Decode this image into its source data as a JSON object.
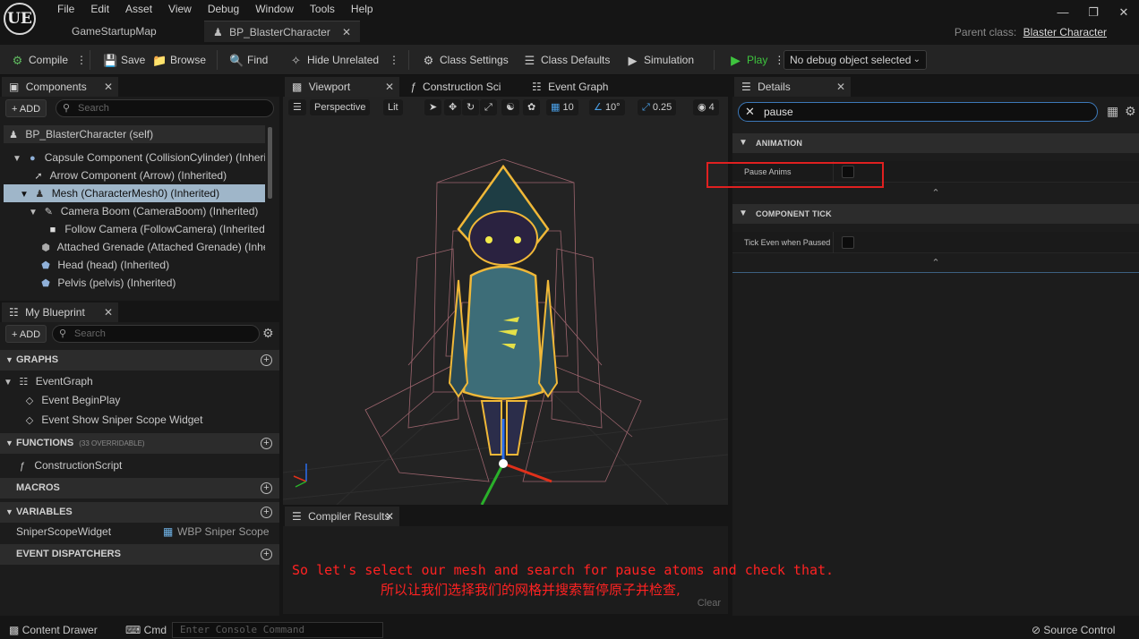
{
  "app": {
    "logo": "UE"
  },
  "menu": [
    "File",
    "Edit",
    "Asset",
    "View",
    "Debug",
    "Window",
    "Tools",
    "Help"
  ],
  "window_controls": {
    "minimize": "—",
    "maximize": "❐",
    "close": "✕"
  },
  "doc_tabs": [
    {
      "label": "GameStartupMap"
    },
    {
      "label": "BP_BlasterCharacter",
      "close": "✕"
    }
  ],
  "parent_class": {
    "label": "Parent class:",
    "value": "Blaster Character"
  },
  "toolbar": {
    "compile": "Compile",
    "save": "Save",
    "browse": "Browse",
    "find": "Find",
    "hide_unrelated": "Hide Unrelated",
    "class_settings": "Class Settings",
    "class_defaults": "Class Defaults",
    "simulation": "Simulation",
    "play": "Play",
    "debug_select": "No debug object selected",
    "accent_play": "#3ec43e"
  },
  "components": {
    "tab": "Components",
    "add": "ADD",
    "search_placeholder": "Search",
    "items": [
      {
        "label": "BP_BlasterCharacter (self)"
      },
      {
        "label": "Capsule Component (CollisionCylinder) (Inherite"
      },
      {
        "label": "Arrow Component (Arrow) (Inherited)"
      },
      {
        "label": "Mesh (CharacterMesh0) (Inherited)"
      },
      {
        "label": "Camera Boom (CameraBoom) (Inherited)"
      },
      {
        "label": "Follow Camera (FollowCamera) (Inherited)"
      },
      {
        "label": "Attached Grenade (Attached Grenade) (Inheri"
      },
      {
        "label": "Head (head) (Inherited)"
      },
      {
        "label": "Pelvis (pelvis) (Inherited)"
      }
    ],
    "selected_color": "#9fb6c9"
  },
  "my_blueprint": {
    "tab": "My Blueprint",
    "add": "ADD",
    "search_placeholder": "Search",
    "graphs": "GRAPHS",
    "event_graph": "EventGraph",
    "event_begin_play": "Event BeginPlay",
    "event_show_sniper": "Event Show Sniper Scope Widget",
    "functions": "FUNCTIONS",
    "functions_sub": "(33 OVERRIDABLE)",
    "construction_script": "ConstructionScript",
    "macros": "MACROS",
    "variables": "VARIABLES",
    "var_name": "SniperScopeWidget",
    "var_type": "WBP Sniper Scope",
    "event_dispatchers": "EVENT DISPATCHERS"
  },
  "center_tabs": [
    {
      "label": "Viewport"
    },
    {
      "label": "Construction Sci"
    },
    {
      "label": "Event Graph"
    }
  ],
  "viewport": {
    "perspective": "Perspective",
    "lit": "Lit",
    "grid": "10",
    "angle": "10°",
    "scale": "0.25",
    "camera_speed": "4"
  },
  "compiler": {
    "tab": "Compiler Results",
    "clear": "Clear"
  },
  "details": {
    "tab": "Details",
    "search_value": "pause",
    "categories": [
      {
        "title": "ANIMATION",
        "prop": "Pause Anims"
      },
      {
        "title": "COMPONENT TICK",
        "prop": "Tick Even when Paused"
      }
    ],
    "highlight_color": "#e02020"
  },
  "bottom": {
    "content_drawer": "Content Drawer",
    "cmd": "Cmd",
    "console_placeholder": "Enter Console Command",
    "source_control": "Source Control"
  },
  "subtitles": {
    "en": "So let's select our mesh and search for pause atoms and check that.",
    "zh": "所以让我们选择我们的网格并搜索暂停原子并检查,"
  }
}
